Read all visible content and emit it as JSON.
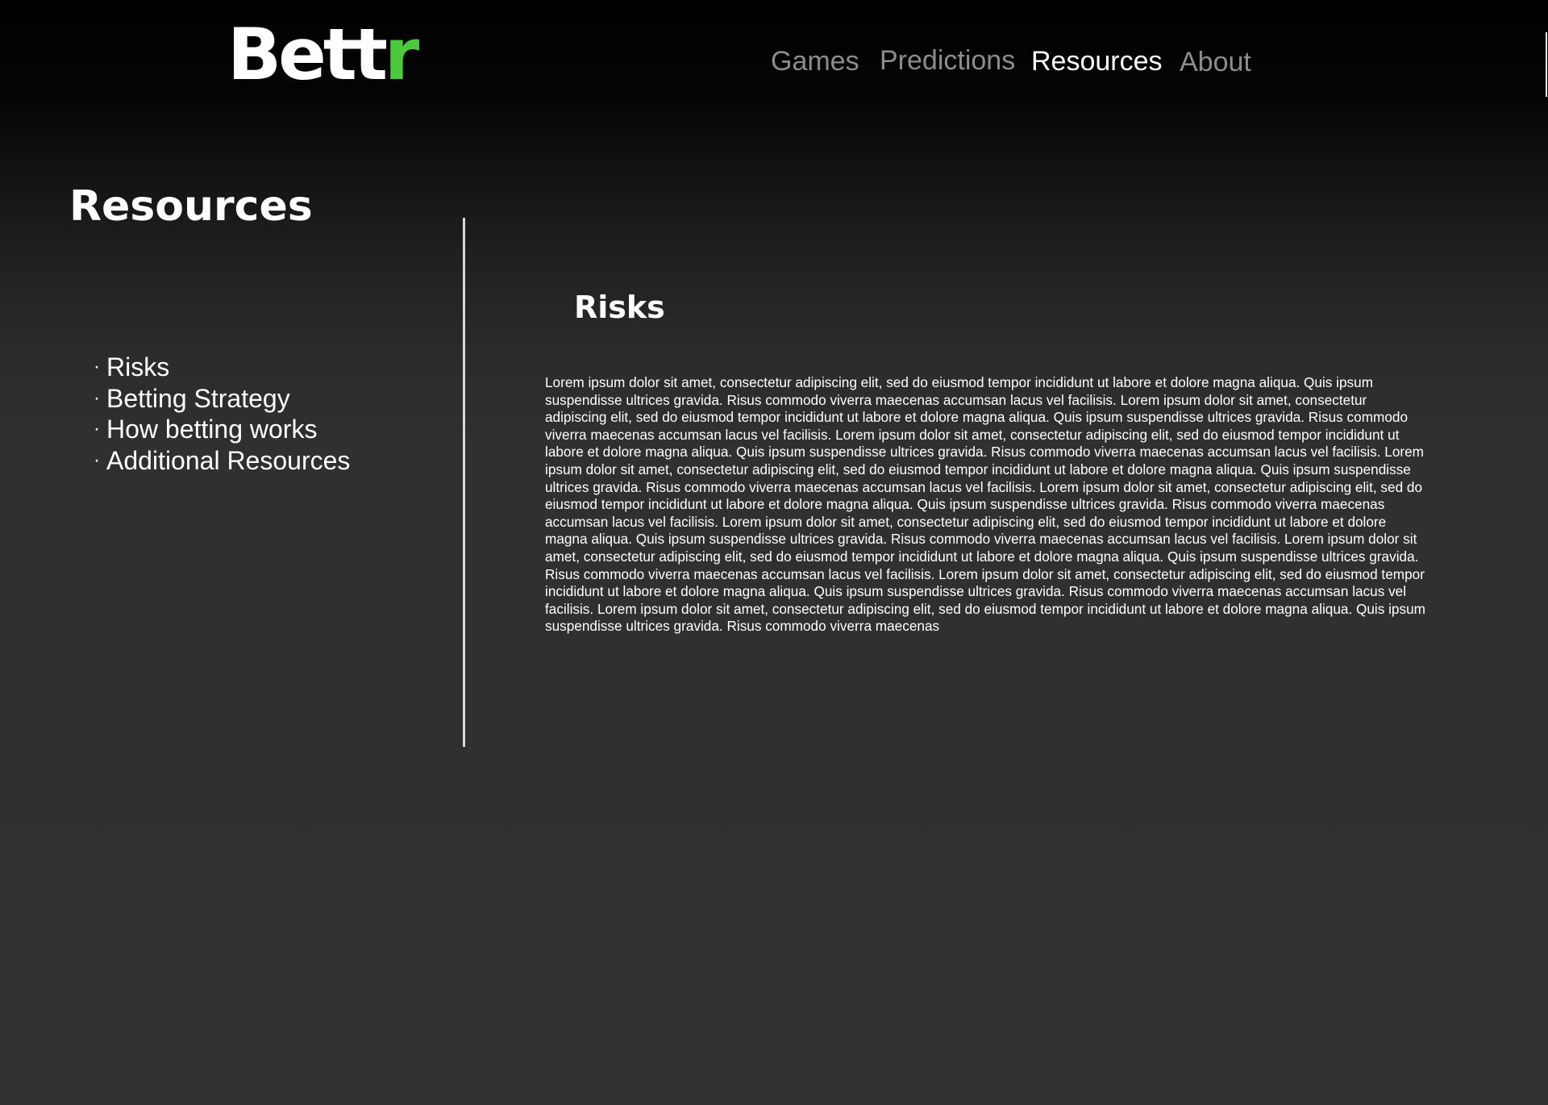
{
  "brand": {
    "logo_main": "Bett",
    "logo_accent": "r",
    "accent_color": "#4cc93c"
  },
  "nav": {
    "items": [
      {
        "label": "Games",
        "active": false
      },
      {
        "label": "Predictions",
        "active": false
      },
      {
        "label": "Resources",
        "active": true
      },
      {
        "label": "About",
        "active": false
      }
    ]
  },
  "page": {
    "title": "Resources"
  },
  "sidebar": {
    "bullet": "·",
    "items": [
      {
        "label": "Risks"
      },
      {
        "label": "Betting Strategy"
      },
      {
        "label": "How betting works"
      },
      {
        "label": "Additional Resources"
      }
    ]
  },
  "content": {
    "section_title": "Risks",
    "body": "Lorem ipsum dolor sit amet, consectetur adipiscing elit, sed do eiusmod tempor incididunt ut labore et dolore magna aliqua. Quis ipsum suspendisse ultrices gravida. Risus commodo viverra maecenas accumsan lacus vel facilisis. Lorem ipsum dolor sit amet, consectetur adipiscing elit, sed do eiusmod tempor incididunt ut labore et dolore magna aliqua. Quis ipsum suspendisse ultrices gravida. Risus commodo viverra maecenas accumsan lacus vel facilisis. Lorem ipsum dolor sit amet, consectetur adipiscing elit, sed do eiusmod tempor incididunt ut labore et dolore magna aliqua. Quis ipsum suspendisse ultrices gravida. Risus commodo viverra maecenas accumsan lacus vel facilisis. Lorem ipsum dolor sit amet, consectetur adipiscing elit, sed do eiusmod tempor incididunt ut labore et dolore magna aliqua. Quis ipsum suspendisse ultrices gravida. Risus commodo viverra maecenas accumsan lacus vel facilisis. Lorem ipsum dolor sit amet, consectetur adipiscing elit, sed do eiusmod tempor incididunt ut labore et dolore magna aliqua. Quis ipsum suspendisse ultrices gravida. Risus commodo viverra maecenas accumsan lacus vel facilisis. Lorem ipsum dolor sit amet, consectetur adipiscing elit, sed do eiusmod tempor incididunt ut labore et dolore magna aliqua. Quis ipsum suspendisse ultrices gravida. Risus commodo viverra maecenas accumsan lacus vel facilisis. Lorem ipsum dolor sit amet, consectetur adipiscing elit, sed do eiusmod tempor incididunt ut labore et dolore magna aliqua. Quis ipsum suspendisse ultrices gravida. Risus commodo viverra maecenas accumsan lacus vel facilisis. Lorem ipsum dolor sit amet, consectetur adipiscing elit, sed do eiusmod tempor incididunt ut labore et dolore magna aliqua. Quis ipsum suspendisse ultrices gravida. Risus commodo viverra maecenas accumsan lacus vel facilisis. Lorem ipsum dolor sit amet, consectetur adipiscing elit, sed do eiusmod tempor incididunt ut labore et dolore magna aliqua. Quis ipsum suspendisse ultrices gravida. Risus commodo viverra maecenas"
  },
  "colors": {
    "background_top": "#000000",
    "background_bottom": "#313131",
    "nav_inactive": "#8c8c8c",
    "nav_active": "#ffffff",
    "divider": "#d8d8d8"
  }
}
